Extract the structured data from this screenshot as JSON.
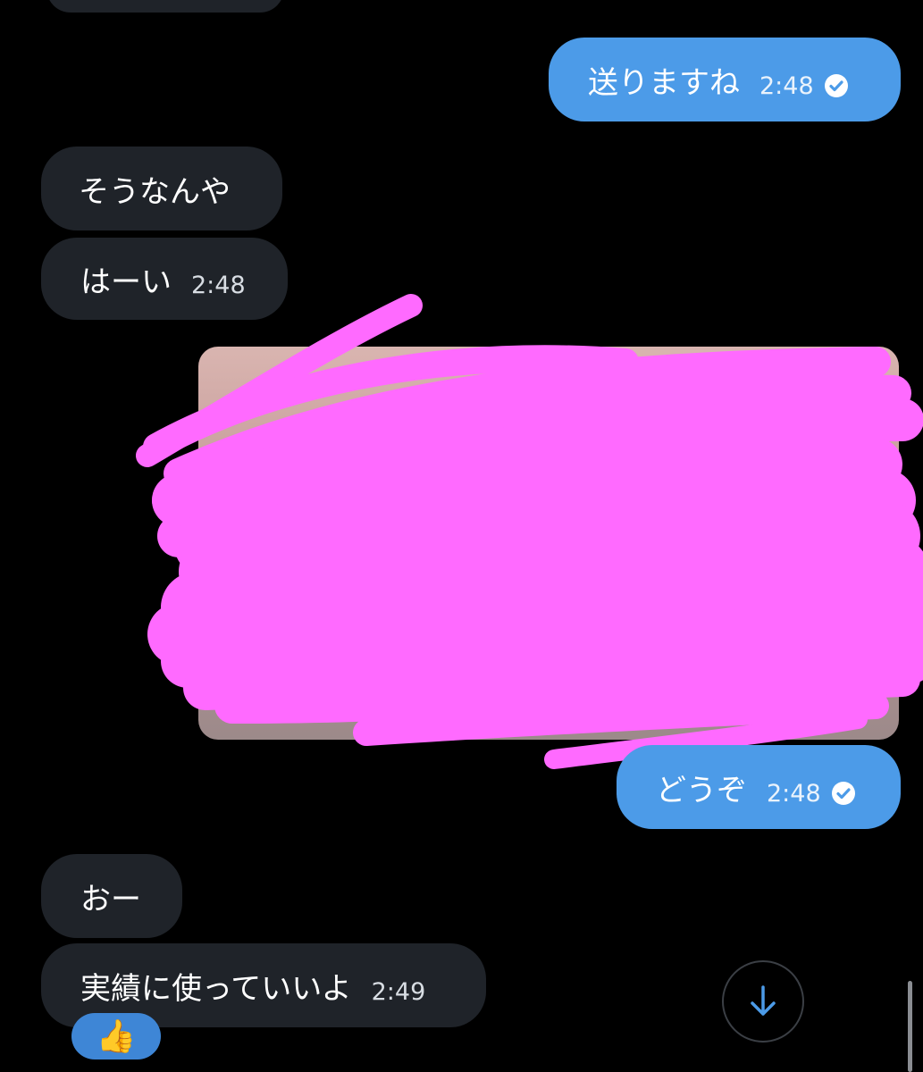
{
  "messages": [
    {
      "side": "in",
      "text": "",
      "time": ""
    },
    {
      "side": "out",
      "text": "送りますね",
      "time": "2:48"
    },
    {
      "side": "in",
      "text": "そうなんや",
      "time": ""
    },
    {
      "side": "in",
      "text": "はーい",
      "time": "2:48"
    },
    {
      "side": "out",
      "text": "どうぞ",
      "time": "2:48"
    },
    {
      "side": "in",
      "text": "おー",
      "time": ""
    },
    {
      "side": "in",
      "text": "実績に使っていいよ",
      "time": "2:49"
    }
  ],
  "reaction": {
    "emoji": "👍"
  },
  "colors": {
    "background": "#000000",
    "incoming_bubble": "#1f2329",
    "outgoing_bubble": "#4c9be8",
    "scribble": "#ff6aff"
  },
  "icons": {
    "read_receipt": "check-circle-icon",
    "scroll_down": "arrow-down-icon"
  }
}
